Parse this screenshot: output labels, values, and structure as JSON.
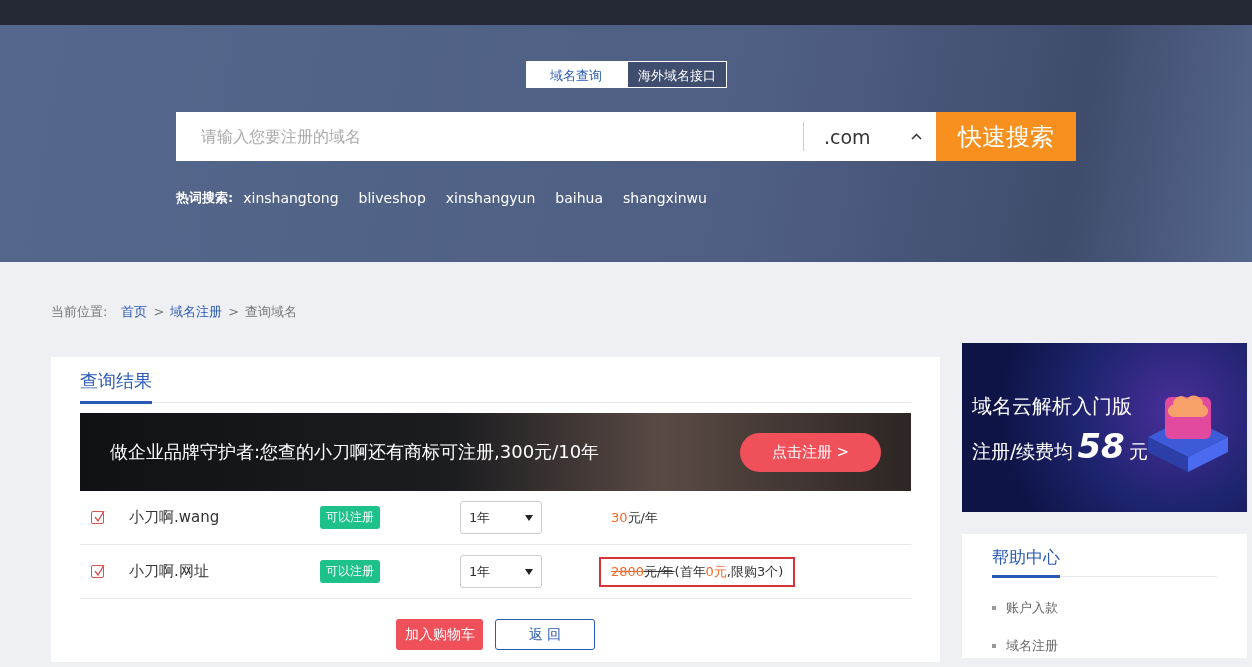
{
  "hero": {
    "tabs": [
      {
        "label": "域名查询",
        "selected": true
      },
      {
        "label": "海外域名接口",
        "selected": false
      }
    ],
    "search": {
      "placeholder": "请输入您要注册的域名",
      "suffix": ".com",
      "button": "快速搜索"
    },
    "hot_label": "热词搜索:",
    "hot_words": [
      "xinshangtong",
      "bliveshop",
      "xinshangyun",
      "baihua",
      "shangxinwu"
    ]
  },
  "breadcrumb": {
    "label": "当前位置:",
    "links": [
      "首页",
      "域名注册"
    ],
    "current": "查询域名",
    "separator": ">"
  },
  "results": {
    "title": "查询结果",
    "banner": {
      "text": "做企业品牌守护者:您查的小刀啊还有商标可注册,300元/10年",
      "button": "点击注册 >"
    },
    "rows": [
      {
        "checked": true,
        "domain": "小刀啊.wang",
        "status": "可以注册",
        "period": "1年",
        "highlighted": false,
        "price_parts": [
          {
            "text": "30",
            "kind": "accent",
            "struck": false
          },
          {
            "text": "元/年",
            "kind": "plain",
            "struck": false
          }
        ]
      },
      {
        "checked": true,
        "domain": "小刀啊.网址",
        "status": "可以注册",
        "period": "1年",
        "highlighted": true,
        "price_parts": [
          {
            "text": "2800",
            "kind": "accent",
            "struck": true
          },
          {
            "text": "元/年",
            "kind": "plain",
            "struck": true
          },
          {
            "text": "(首年",
            "kind": "plain",
            "struck": false
          },
          {
            "text": "0元",
            "kind": "accent",
            "struck": false
          },
          {
            "text": ",限购3个)",
            "kind": "plain",
            "struck": false
          }
        ]
      }
    ],
    "buttons": [
      {
        "label": "加入购物车",
        "kind": "primary"
      },
      {
        "label": "返 回",
        "kind": "outline"
      }
    ]
  },
  "side": {
    "promo": {
      "title": "域名云解析入门版",
      "line": "注册/续费均",
      "amount": "58",
      "unit": "元"
    },
    "help": {
      "title": "帮助中心",
      "items": [
        "账户入款",
        "域名注册"
      ]
    }
  }
}
